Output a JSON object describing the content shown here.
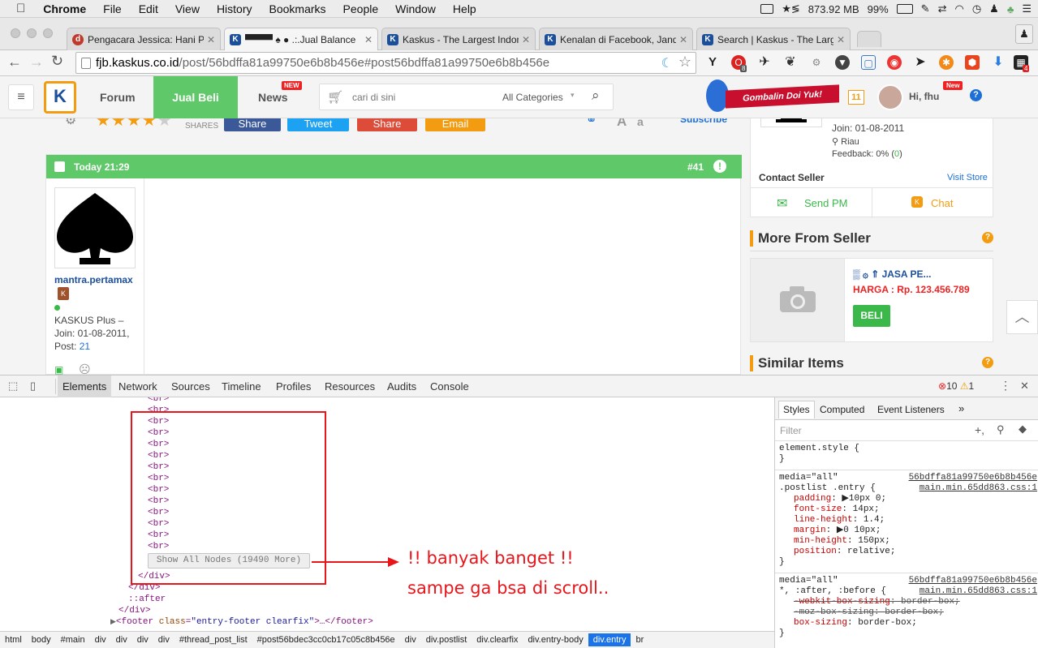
{
  "menubar": {
    "app": "Chrome",
    "items": [
      "File",
      "Edit",
      "View",
      "History",
      "Bookmarks",
      "People",
      "Window",
      "Help"
    ],
    "memory": "873.92 MB",
    "battery": "99%"
  },
  "tabs": [
    {
      "label": "Pengacara Jessica: Hani Pe",
      "fav": "d"
    },
    {
      "label": "▀▀▀▀ ♠ ● .:.Jual Balance",
      "fav": "K"
    },
    {
      "label": "Kaskus - The Largest Indon",
      "fav": "K"
    },
    {
      "label": "Kenalan di Facebook, Janda",
      "fav": "K"
    },
    {
      "label": "Search | Kaskus - The Larg",
      "fav": "K"
    }
  ],
  "toolbar": {
    "url_host": "fjb.kaskus.co.id",
    "url_path": "/post/56bdffa81a99750e6b8b456e#post56bdffa81a99750e6b8b456e",
    "ext_badge1": "8",
    "ext_badge2": "4"
  },
  "kaskus": {
    "nav": [
      "Forum",
      "Jual Beli",
      "News"
    ],
    "new_badge": "NEW",
    "search_placeholder": "cari di sini",
    "category": "All Categories",
    "banner": "Gombalin Doi Yuk!",
    "notif_count": "11",
    "greeting": "Hi, fhu",
    "new_badge2": "New"
  },
  "share": {
    "shares": "SHARES",
    "share": "Share",
    "tweet": "Tweet",
    "gplus": "Share",
    "email": "Email",
    "font_a1": "A",
    "font_a2": "a",
    "subscribe": "Subscribe"
  },
  "post": {
    "time": "Today 21:29",
    "number": "#41",
    "username": "mantra.pertamax",
    "rank": "KASKUS Plus –",
    "join": "Join: 01-08-2011,",
    "post_label": "Post:",
    "post_count": "21"
  },
  "seller": {
    "join": "Join: 01-08-2011",
    "location": "Riau",
    "feedback": "Feedback: 0% (",
    "feedback_val": "0",
    "feedback_end": ")",
    "contact": "Contact Seller",
    "visit": "Visit Store",
    "pm": "Send PM",
    "chat": "Chat"
  },
  "more": {
    "title": "More From Seller",
    "item_name": "▒ ۞ ⇑ JASA PE...",
    "price": "HARGA : Rp. 123.456.789",
    "buy": "BELI",
    "similar": "Similar Items"
  },
  "devtools": {
    "tabs": [
      "Elements",
      "Network",
      "Sources",
      "Timeline",
      "Profiles",
      "Resources",
      "Audits",
      "Console"
    ],
    "errors": "10",
    "warnings": "1",
    "br_lines": [
      "<br>",
      "<br>",
      "<br>",
      "<br>",
      "<br>",
      "<br>",
      "<br>",
      "<br>",
      "<br>",
      "<br>",
      "<br>",
      "<br>",
      "<br>",
      "<br>"
    ],
    "show_all": "Show All Nodes (19490 More)",
    "close_div1": "</div>",
    "close_div2": "</div>",
    "after": "::after",
    "close_div3": "</div>",
    "footer_open": "<footer ",
    "footer_attr": "class",
    "footer_val": "\"entry-footer clearfix\"",
    "footer_rest": ">…</footer>",
    "annotation1": "!! banyak banget !!",
    "annotation2": "sampe ga bsa di scroll..",
    "annotation_color": "#e8161b",
    "breadcrumbs": [
      "html",
      "body",
      "#main",
      "div",
      "div",
      "div",
      "div",
      "#thread_post_list",
      "#post56bdec3cc0cb17c05c8b456e",
      "div",
      "div.postlist",
      "div.clearfix",
      "div.entry-body",
      "div.entry",
      "br"
    ],
    "styles_tabs": [
      "Styles",
      "Computed",
      "Event Listeners",
      "»"
    ],
    "filter": "Filter",
    "elstyle": "element.style {",
    "closebrace": "}",
    "media1": "media=\"all\"",
    "file1": "56bdffa81a99750e6b8b456e",
    "selector1": ".postlist .entry {",
    "src1": "main.min.65dd863.css:1",
    "rules1": [
      [
        "padding",
        "▶10px 0;"
      ],
      [
        "font-size",
        "14px;"
      ],
      [
        "line-height",
        "1.4;"
      ],
      [
        "margin",
        "▶0 10px;"
      ],
      [
        "min-height",
        "150px;"
      ],
      [
        "position",
        "relative;"
      ]
    ],
    "media2": "media=\"all\"",
    "file2": "56bdffa81a99750e6b8b456e",
    "selector2": "*, :after, :before {",
    "src2": "main.min.65dd863.css:1",
    "rules2": [
      [
        "-webkit-box-sizing",
        "border-box;"
      ],
      [
        "-moz-box-sizing",
        "border-box;"
      ],
      [
        "box-sizing",
        "border-box;"
      ]
    ]
  }
}
